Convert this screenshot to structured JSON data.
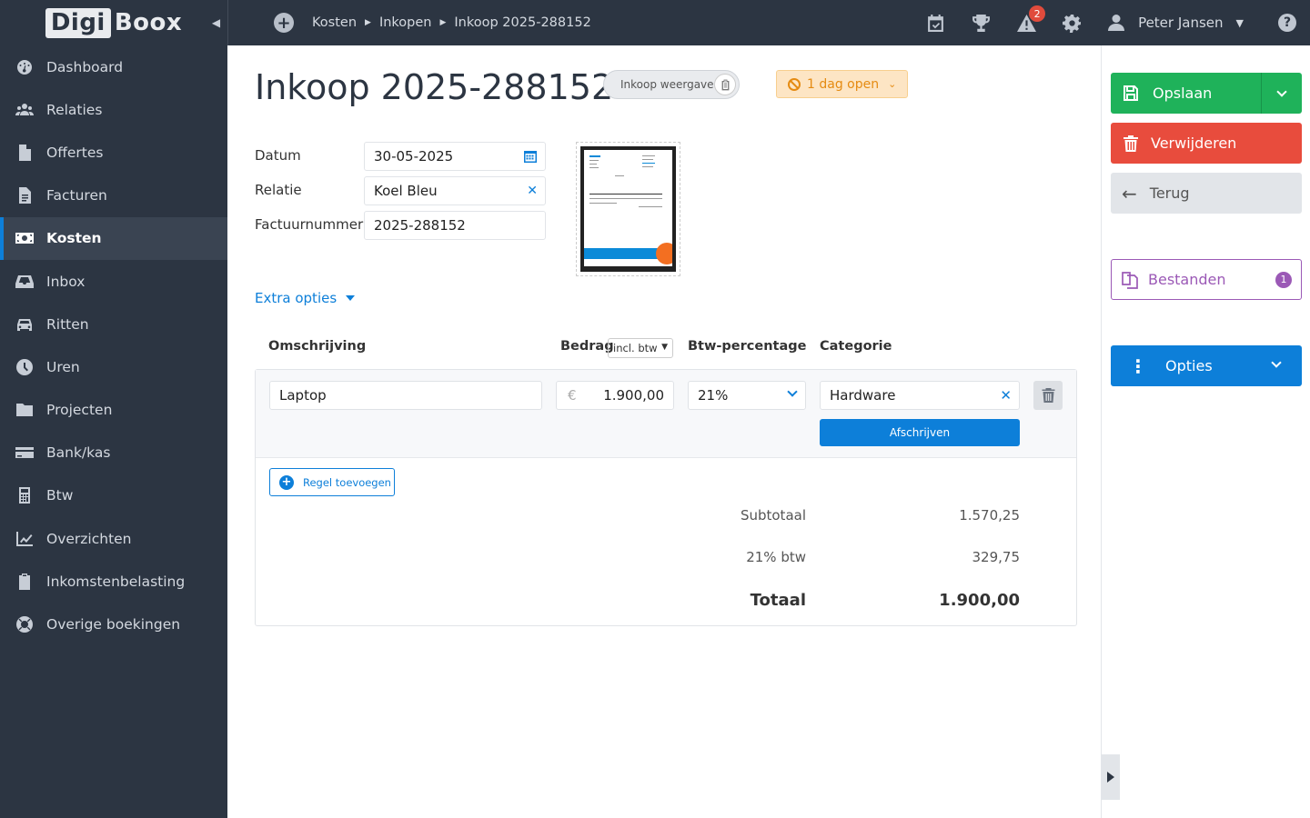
{
  "app": {
    "logo_part1": "Digi",
    "logo_part2": "Boox",
    "accent_color": "#0d7fd9",
    "sidebar_color": "#2c3542"
  },
  "sidebar": {
    "items": [
      {
        "label": "Dashboard",
        "icon": "dashboard-icon"
      },
      {
        "label": "Relaties",
        "icon": "users-icon"
      },
      {
        "label": "Offertes",
        "icon": "file-icon"
      },
      {
        "label": "Facturen",
        "icon": "invoice-icon"
      },
      {
        "label": "Kosten",
        "icon": "money-icon",
        "active": true
      },
      {
        "label": "Inbox",
        "icon": "inbox-icon"
      },
      {
        "label": "Ritten",
        "icon": "car-icon"
      },
      {
        "label": "Uren",
        "icon": "clock-icon"
      },
      {
        "label": "Projecten",
        "icon": "folder-icon"
      },
      {
        "label": "Bank/kas",
        "icon": "credit-card-icon"
      },
      {
        "label": "Btw",
        "icon": "calculator-icon"
      },
      {
        "label": "Overzichten",
        "icon": "line-chart-icon"
      },
      {
        "label": "Inkomstenbelasting",
        "icon": "clipboard-icon"
      },
      {
        "label": "Overige boekingen",
        "icon": "lifebuoy-icon"
      }
    ]
  },
  "topbar": {
    "breadcrumb": [
      "Kosten",
      "Inkopen",
      "Inkoop 2025-288152"
    ],
    "notifications_count": "2",
    "user_name": "Peter Jansen",
    "help": "?"
  },
  "page": {
    "title": "Inkoop 2025-288152",
    "view_toggle": "Inkoop weergave",
    "status": "1 dag open",
    "form": {
      "datum_label": "Datum",
      "datum_value": "30-05-2025",
      "relatie_label": "Relatie",
      "relatie_value": "Koel Bleu",
      "factuurnummer_label": "Factuurnummer",
      "factuurnummer_value": "2025-288152"
    },
    "extra_options": "Extra opties",
    "columns": {
      "omschrijving": "Omschrijving",
      "bedrag": "Bedrag",
      "bedrag_mode": "incl. btw",
      "btw": "Btw-percentage",
      "categorie": "Categorie"
    },
    "lines": [
      {
        "omschrijving": "Laptop",
        "currency": "€",
        "bedrag": "1.900,00",
        "btw": "21%",
        "categorie": "Hardware",
        "action": "Afschrijven"
      }
    ],
    "add_line": "Regel toevoegen",
    "totals": {
      "subtotaal_label": "Subtotaal",
      "subtotaal_value": "1.570,25",
      "btw_label": "21% btw",
      "btw_value": "329,75",
      "totaal_label": "Totaal",
      "totaal_value": "1.900,00"
    }
  },
  "actions": {
    "save": "Opslaan",
    "delete": "Verwijderen",
    "back": "Terug",
    "files": "Bestanden",
    "files_count": "1",
    "options": "Opties",
    "save_color": "#1fb25a",
    "delete_color": "#e84c3d",
    "files_color": "#9b59b6"
  }
}
